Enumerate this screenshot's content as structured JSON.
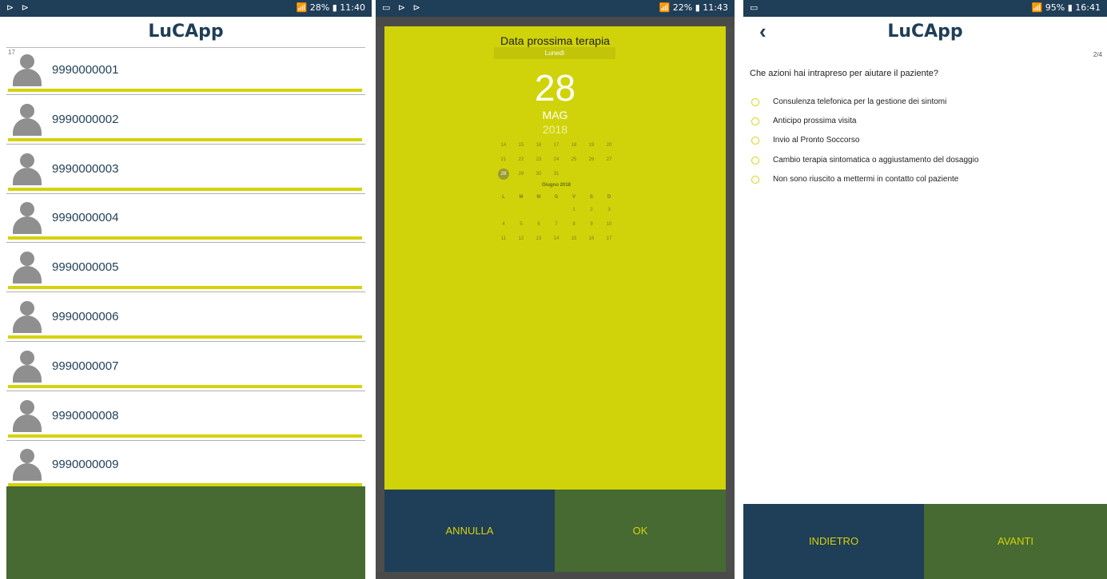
{
  "screen1": {
    "status_left": "⊳ ⊳",
    "status_right": "📶 28% ▮ 11:40",
    "app_title": "LuCApp",
    "count": "17",
    "patients": [
      "9990000001",
      "9990000002",
      "9990000003",
      "9990000004",
      "9990000005",
      "9990000006",
      "9990000007",
      "9990000008",
      "9990000009"
    ],
    "colors": {
      "accent": "#d6d20c",
      "navy": "#1f3e57",
      "green": "#466a31"
    }
  },
  "screen2": {
    "status_left": "▭ ⊳ ⊳",
    "status_right": "📶 22% ▮ 11:43",
    "dialog_title": "Data prossima terapia",
    "weekday": "Lunedì",
    "day": "28",
    "month": "MAG",
    "year": "2018",
    "week1": [
      "14",
      "15",
      "16",
      "17",
      "18",
      "19",
      "20"
    ],
    "week2": [
      "21",
      "22",
      "23",
      "24",
      "25",
      "26",
      "27"
    ],
    "week3": [
      "28",
      "29",
      "30",
      "31"
    ],
    "next_month_label": "Giugno 2018",
    "weekday_headers": [
      "L",
      "M",
      "M",
      "G",
      "V",
      "S",
      "D"
    ],
    "june_week1": [
      "1",
      "2",
      "3"
    ],
    "june_week2": [
      "4",
      "5",
      "6",
      "7",
      "8",
      "9",
      "10"
    ],
    "june_week3": [
      "11",
      "12",
      "13",
      "14",
      "15",
      "16",
      "17"
    ],
    "cancel_label": "ANNULLA",
    "ok_label": "OK",
    "colors": {
      "dialog_bg": "#d0d309"
    }
  },
  "screen3": {
    "status_left": "▭",
    "status_right": "📶 95% ▮ 16:41",
    "back_icon": "‹",
    "app_title": "LuCApp",
    "step": "2/4",
    "question": "Che azioni hai intrapreso per aiutare il paziente?",
    "options": [
      "Consulenza telefonica per la gestione dei sintomi",
      "Anticipo prossima visita",
      "Invio al Pronto Soccorso",
      "Cambio terapia sintomatica o aggiustamento del dosaggio",
      "Non sono riuscito a mettermi in contatto col paziente"
    ],
    "back_label": "INDIETRO",
    "next_label": "AVANTI"
  }
}
